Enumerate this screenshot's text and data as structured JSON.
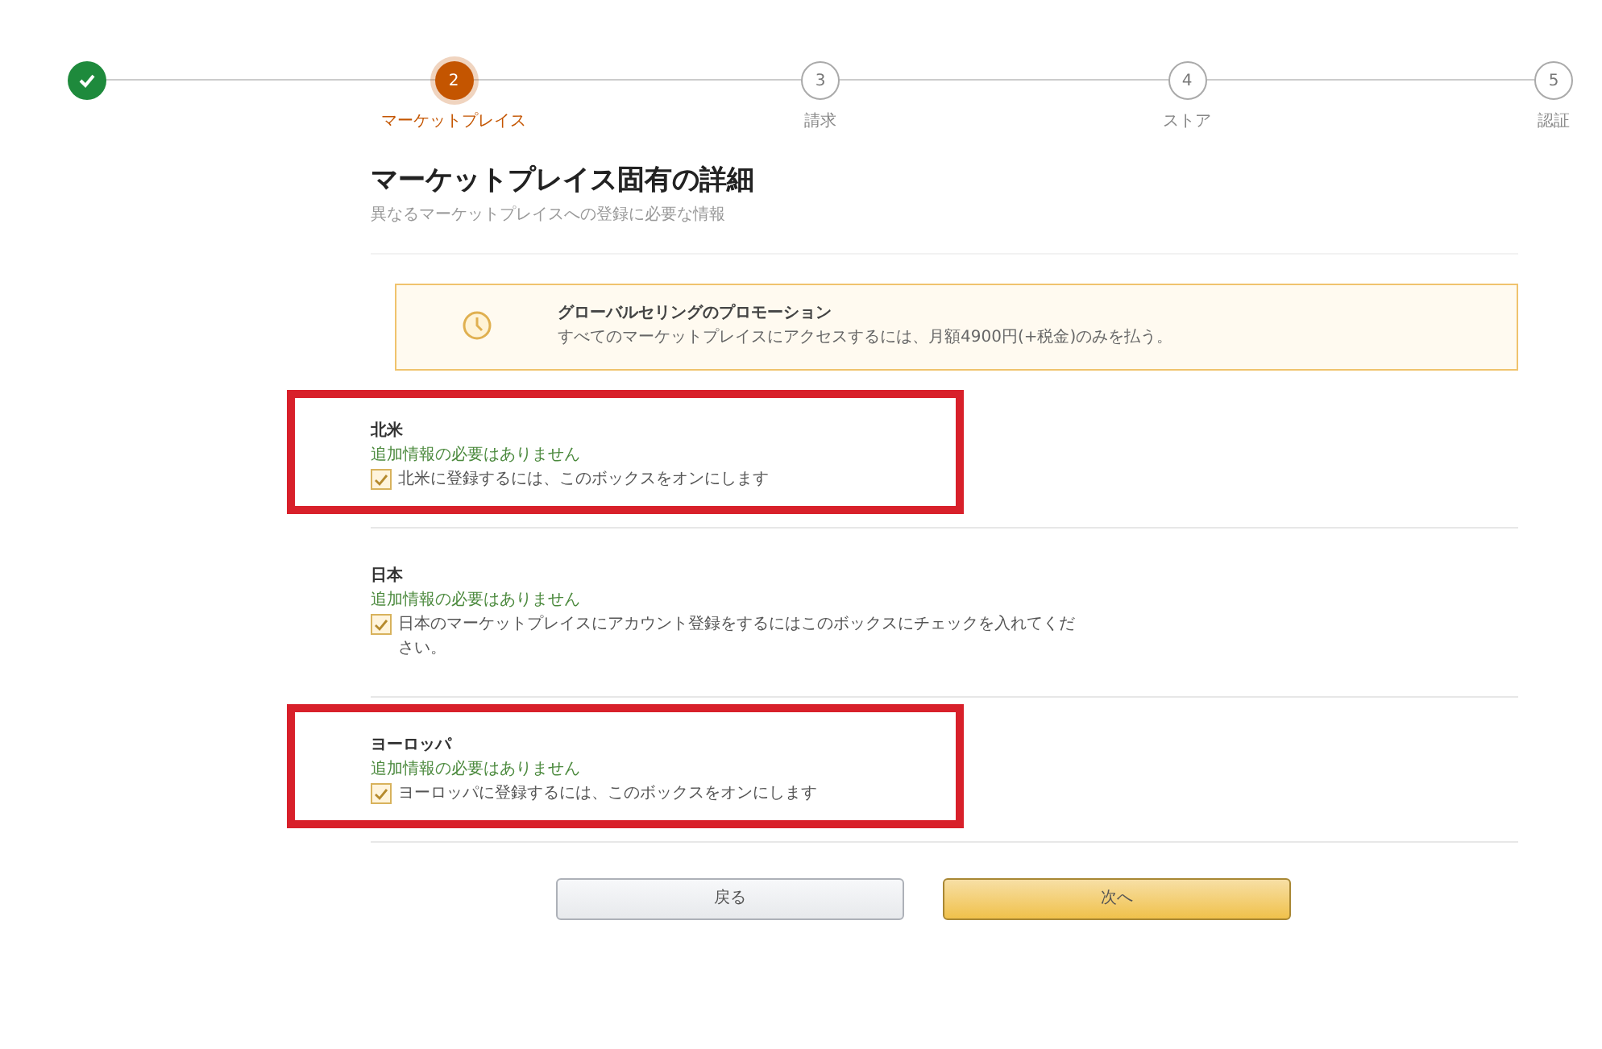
{
  "steps": [
    {
      "done": true,
      "selected": false
    },
    {
      "number": "2",
      "label": "マーケットプレイス",
      "done": false,
      "selected": true
    },
    {
      "number": "3",
      "label": "請求",
      "done": false,
      "selected": false
    },
    {
      "number": "4",
      "label": "ストア",
      "done": false,
      "selected": false
    },
    {
      "number": "5",
      "label": "認証",
      "done": false,
      "selected": false
    }
  ],
  "heading": {
    "title": "マーケットプレイス固有の詳細",
    "subtitle": "異なるマーケットプレイスへの登録に必要な情報"
  },
  "promotion": {
    "title": "グローバルセリングのプロモーション",
    "text": "すべてのマーケットプレイスにアクセスするには、月額4900円(+税金)のみを払う。"
  },
  "regions": [
    {
      "name": "北米",
      "note": "追加情報の必要はありません",
      "checkbox_label": "北米に登録するには、このボックスをオンにします",
      "checked": true,
      "highlighted": true
    },
    {
      "name": "日本",
      "note": "追加情報の必要はありません",
      "checkbox_label": "日本のマーケットプレイスにアカウント登録をするにはこのボックスにチェックを入れてください。",
      "checked": true,
      "highlighted": false
    },
    {
      "name": "ヨーロッパ",
      "note": "追加情報の必要はありません",
      "checkbox_label": "ヨーロッパに登録するには、このボックスをオンにします",
      "checked": true,
      "highlighted": true
    }
  ],
  "buttons": [
    {
      "label": "戻る",
      "kind": "secondary"
    },
    {
      "label": "次へ",
      "kind": "primary"
    }
  ]
}
